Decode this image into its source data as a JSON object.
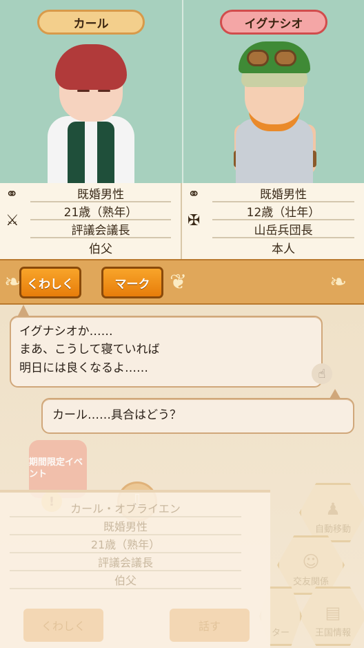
{
  "left_character": {
    "name": "カール",
    "marital": "既婚男性",
    "age": "21歳（熟年）",
    "role": "評議会議長",
    "relation": "伯父",
    "icons": [
      "ring-icon",
      "crossed-swords-icon"
    ]
  },
  "right_character": {
    "name": "イグナシオ",
    "marital": "既婚男性",
    "age": "12歳（壮年）",
    "role": "山岳兵団長",
    "relation": "本人",
    "icons": [
      "ring-icon",
      "axe-icon"
    ]
  },
  "buttons": {
    "details": "くわしく",
    "mark": "マーク"
  },
  "dialogue": {
    "line1": "イグナシオか……",
    "line2": "まあ、こうして寝ていれば",
    "line3": "明日には良くなるよ……",
    "reply": "カール……具合はどう？"
  },
  "background": {
    "event_badge": "期間限定イベント",
    "alert": "!",
    "card": {
      "name": "カール・オブライエン",
      "marital": "既婚男性",
      "age": "21歳（熟年）",
      "role": "評議会議長",
      "relation": "伯父",
      "details_button": "くわしく",
      "talk_button": "話す"
    },
    "hex_menu": {
      "auto_move": "自動移動",
      "relations": "交友関係",
      "map": "王国情報",
      "other": "ター"
    }
  },
  "colors": {
    "portrait_bg": "#a7d0be",
    "button_orange": "#f39a1e",
    "pill_left": "#f3cf8c",
    "pill_right": "#f4a6a6",
    "bar": "#e0a75a"
  }
}
